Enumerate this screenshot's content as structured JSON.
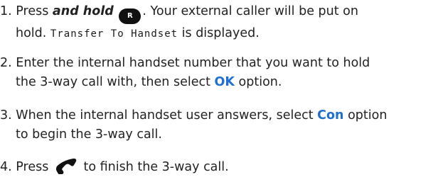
{
  "colors": {
    "text": "#222222",
    "accent": "#1f6fcf",
    "key_fill": "#111111"
  },
  "steps": [
    {
      "num": "1.",
      "press": "Press",
      "and_hold": "and hold",
      "key_label": "R",
      "after_key": ". Your external caller will be put on",
      "line2_pre": "hold.",
      "display_text": "Transfer To Handset",
      "line2_post": "is displayed."
    },
    {
      "num": "2.",
      "line1": "Enter the internal handset number that you want to hold",
      "line2_pre": "the 3-way call with, then select",
      "option": "OK",
      "line2_post": "option."
    },
    {
      "num": "3.",
      "line1_pre": "When the internal handset user answers, select",
      "option": "Con",
      "line1_post": "option",
      "line2": "to begin the 3-way call."
    },
    {
      "num": "4.",
      "pre": "Press",
      "icon": "end-call-icon",
      "post": "to finish the 3-way call."
    }
  ]
}
